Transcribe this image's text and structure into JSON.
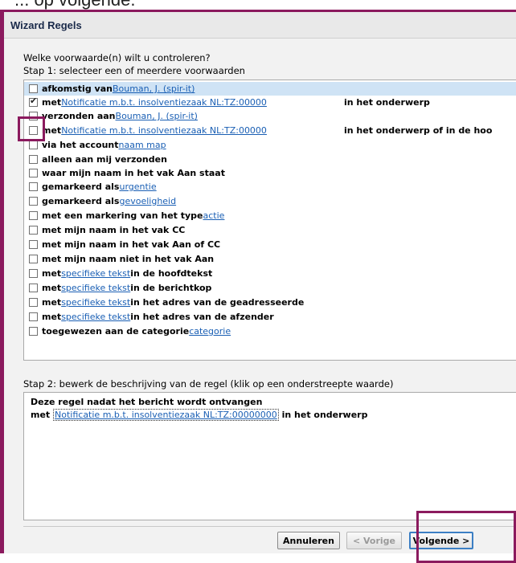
{
  "top_caption": "... op volgende.",
  "window": {
    "title": "Wizard Regels"
  },
  "question": "Welke voorwaarde(n) wilt u controleren?",
  "step1_label": "Stap 1: selecteer een of meerdere voorwaarden",
  "conditions": [
    {
      "prefix": "afkomstig van ",
      "link": "Bouman, J. (spir-it)",
      "after": "",
      "suffix": "",
      "checked": false,
      "highlighted": true
    },
    {
      "prefix": "met ",
      "link": "Notificatie m.b.t. insolventiezaak NL:TZ:00000",
      "after": "",
      "suffix": "in het onderwerp",
      "checked": true,
      "highlighted": false
    },
    {
      "prefix": "verzonden aan ",
      "link": "Bouman, J. (spir-it)",
      "after": "",
      "suffix": "",
      "checked": false,
      "highlighted": false
    },
    {
      "prefix": "met ",
      "link": "Notificatie m.b.t. insolventiezaak NL:TZ:00000",
      "after": "",
      "suffix": "in het onderwerp of in de hoo",
      "checked": false,
      "highlighted": false
    },
    {
      "prefix": "via het account ",
      "link": "naam map",
      "after": "",
      "suffix": "",
      "checked": false,
      "highlighted": false
    },
    {
      "prefix": "alleen aan mij verzonden",
      "link": "",
      "after": "",
      "suffix": "",
      "checked": false,
      "highlighted": false
    },
    {
      "prefix": "waar mijn naam in het vak Aan staat",
      "link": "",
      "after": "",
      "suffix": "",
      "checked": false,
      "highlighted": false
    },
    {
      "prefix": "gemarkeerd als ",
      "link": "urgentie",
      "after": "",
      "suffix": "",
      "checked": false,
      "highlighted": false
    },
    {
      "prefix": "gemarkeerd als ",
      "link": "gevoeligheid",
      "after": "",
      "suffix": "",
      "checked": false,
      "highlighted": false
    },
    {
      "prefix": "met een markering van het type ",
      "link": "actie",
      "after": "",
      "suffix": "",
      "checked": false,
      "highlighted": false
    },
    {
      "prefix": "met mijn naam in het vak CC",
      "link": "",
      "after": "",
      "suffix": "",
      "checked": false,
      "highlighted": false
    },
    {
      "prefix": "met mijn naam in het vak Aan of CC",
      "link": "",
      "after": "",
      "suffix": "",
      "checked": false,
      "highlighted": false
    },
    {
      "prefix": "met mijn naam niet in het vak Aan",
      "link": "",
      "after": "",
      "suffix": "",
      "checked": false,
      "highlighted": false
    },
    {
      "prefix": "met ",
      "link": "specifieke tekst",
      "after": " in de hoofdtekst",
      "suffix": "",
      "checked": false,
      "highlighted": false
    },
    {
      "prefix": "met ",
      "link": "specifieke tekst",
      "after": " in de berichtkop",
      "suffix": "",
      "checked": false,
      "highlighted": false
    },
    {
      "prefix": "met ",
      "link": "specifieke tekst",
      "after": " in het adres van de geadresseerde",
      "suffix": "",
      "checked": false,
      "highlighted": false
    },
    {
      "prefix": "met ",
      "link": "specifieke tekst",
      "after": " in het adres van de afzender",
      "suffix": "",
      "checked": false,
      "highlighted": false
    },
    {
      "prefix": "toegewezen aan de categorie ",
      "link": "categorie",
      "after": "",
      "suffix": "",
      "checked": false,
      "highlighted": false
    }
  ],
  "step2_label": "Stap 2: bewerk de beschrijving van de regel (klik op een onderstreepte waarde)",
  "description": {
    "line1": "Deze regel nadat het bericht wordt ontvangen",
    "line2_prefix": "met ",
    "line2_link": "Notificatie m.b.t. insolventiezaak NL:TZ:00000000",
    "line2_suffix": " in het onderwerp"
  },
  "buttons": {
    "cancel": "Annuleren",
    "back": "< Vorige",
    "next": "Volgende >"
  },
  "colors": {
    "highlight_frame": "#8b1a5e",
    "link": "#1a5fb4",
    "row_highlight": "#cfe3f5"
  }
}
